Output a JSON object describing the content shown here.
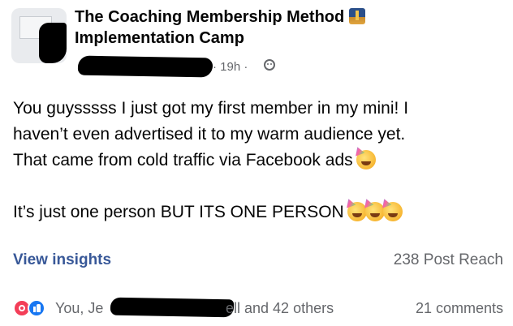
{
  "group": {
    "title_line1": "The Coaching Membership Method",
    "title_line2": "Implementation Camp",
    "badge_icon": "group-cover-icon"
  },
  "meta": {
    "time": "· 19h ·",
    "audience_icon": "group-audience-icon"
  },
  "post": {
    "line1": "You guysssss I just got my first member in my mini! I",
    "line2": "haven’t even advertised it to my warm audience yet.",
    "line3": "That came from cold traffic via Facebook ads",
    "line4": "It’s just one person BUT ITS ONE PERSON",
    "emoji": "partying-face-emoji"
  },
  "insights": {
    "view_label": "View insights",
    "reach": "238 Post Reach"
  },
  "reactions": {
    "icons": [
      "love-reaction-icon",
      "like-reaction-icon"
    ],
    "prefix": "You, Je",
    "suffix": "ell and 42 others",
    "comments": "21 comments"
  },
  "colors": {
    "link_blue": "#385898",
    "secondary_text": "#65676b",
    "like_blue": "#1877f2",
    "love_red": "#f33e58"
  }
}
